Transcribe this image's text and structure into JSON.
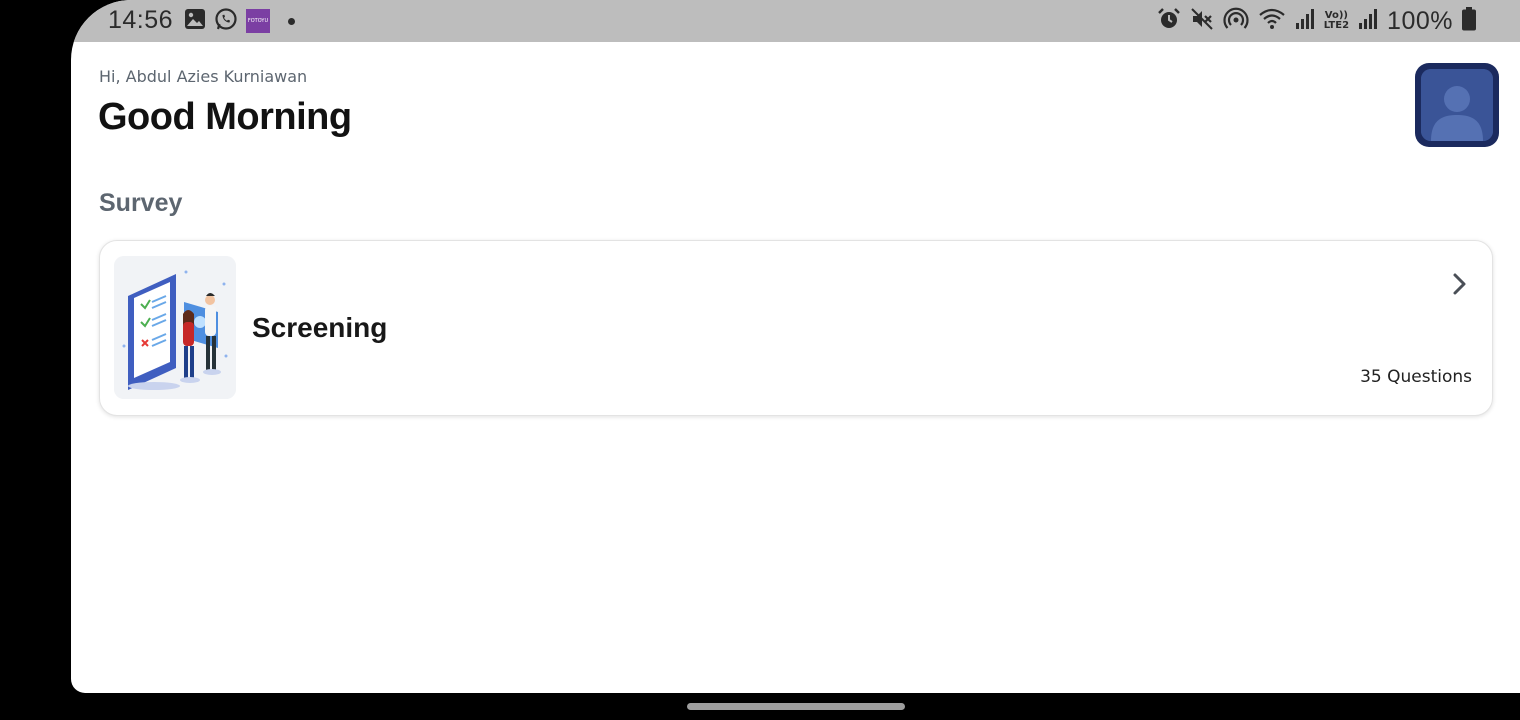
{
  "status_bar": {
    "time": "14:56",
    "battery": "100%",
    "notification_app_label": "FOTOYU",
    "network_label_top": "Vo))",
    "network_label_bottom": "LTE2",
    "left_icons": [
      "gallery-icon",
      "whatsapp-icon",
      "fotoyu-app-icon",
      "notification-dot-icon"
    ],
    "right_icons": [
      "alarm-icon",
      "mute-icon",
      "hotspot-icon",
      "wifi-icon",
      "signal-icon",
      "volte-icon",
      "signal-icon",
      "battery-icon"
    ]
  },
  "header": {
    "greeting": "Hi, Abdul Azies Kurniawan",
    "title": "Good Morning",
    "avatar_icon": "profile-avatar-icon"
  },
  "survey": {
    "section_title": "Survey",
    "items": [
      {
        "title": "Screening",
        "question_count": "35 Questions",
        "thumbnail_icon": "screening-illustration",
        "action_icon": "chevron-right-icon"
      }
    ]
  },
  "colors": {
    "status_bar_bg": "#bdbdbd",
    "page_bg": "#ffffff",
    "avatar_bg": "#1b2a5e",
    "text_primary": "#121212",
    "text_secondary": "#5d6670"
  }
}
